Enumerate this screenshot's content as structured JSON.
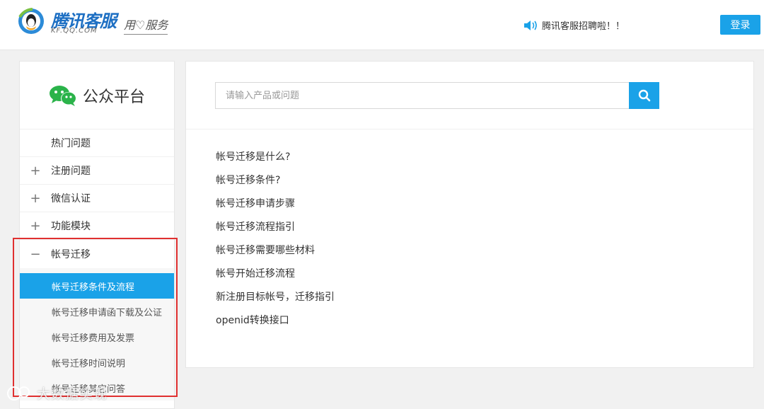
{
  "header": {
    "logo_text": "腾讯客服",
    "logo_sub": "KF.QQ.COM",
    "slogan": "用♡服务",
    "notice": "腾讯客服招聘啦！！",
    "login_label": "登录"
  },
  "sidebar": {
    "brand_label": "公众平台",
    "items": [
      {
        "label": "热门问题",
        "sign": ""
      },
      {
        "label": "注册问题",
        "sign": "+"
      },
      {
        "label": "微信认证",
        "sign": "+"
      },
      {
        "label": "功能模块",
        "sign": "+"
      },
      {
        "label": "帐号迁移",
        "sign": "−"
      }
    ],
    "sub_items": [
      {
        "label": "帐号迁移条件及流程",
        "active": true
      },
      {
        "label": "帐号迁移申请函下载及公证",
        "active": false
      },
      {
        "label": "帐号迁移费用及发票",
        "active": false
      },
      {
        "label": "帐号迁移时间说明",
        "active": false
      },
      {
        "label": "帐号迁移其它问答",
        "active": false
      }
    ]
  },
  "search": {
    "placeholder": "请输入产品或问题"
  },
  "questions": [
    "帐号迁移是什么?",
    "帐号迁移条件?",
    "帐号迁移申请步骤",
    "帐号迁移流程指引",
    "帐号迁移需要哪些材料",
    "帐号开始迁移流程",
    "新注册目标帐号，迁移指引",
    "openid转换接口"
  ],
  "watermark": "大数据实现",
  "colors": {
    "accent": "#1aa2e8",
    "highlight": "#e03030"
  }
}
